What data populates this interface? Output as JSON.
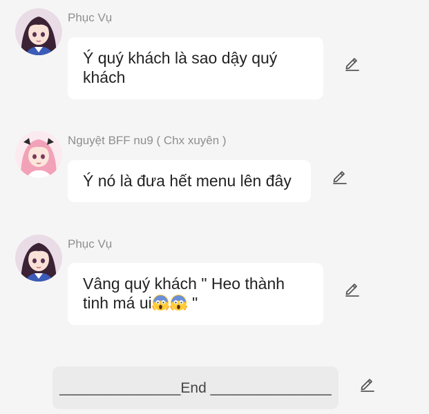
{
  "messages": [
    {
      "sender": "Phục Vụ",
      "text": "Ý quý khách là sao dậy quý khách",
      "avatar": "anime-girl-dark-hair-avatar"
    },
    {
      "sender": "Nguyệt BFF nu9 ( Chx xuyên )",
      "text": "Ý nó là đưa hết menu lên đây",
      "avatar": "anime-girl-pink-hair-avatar"
    },
    {
      "sender": "Phục Vụ",
      "text_before_emoji": "Vâng quý khách \" Heo thành tinh má ui",
      "emojis": [
        "face-screaming-in-fear",
        "face-screaming-in-fear"
      ],
      "text_after_emoji": " \"",
      "avatar": "anime-girl-dark-hair-avatar"
    }
  ],
  "end_message": {
    "text": "_______________End _______________"
  },
  "icons": {
    "edit": "pencil-edit-icon"
  },
  "colors": {
    "background": "#f5f5f5",
    "bubble": "#ffffff",
    "end_bubble": "#ebebeb",
    "sender_name": "#8e8e8e",
    "message_text": "#222222"
  }
}
